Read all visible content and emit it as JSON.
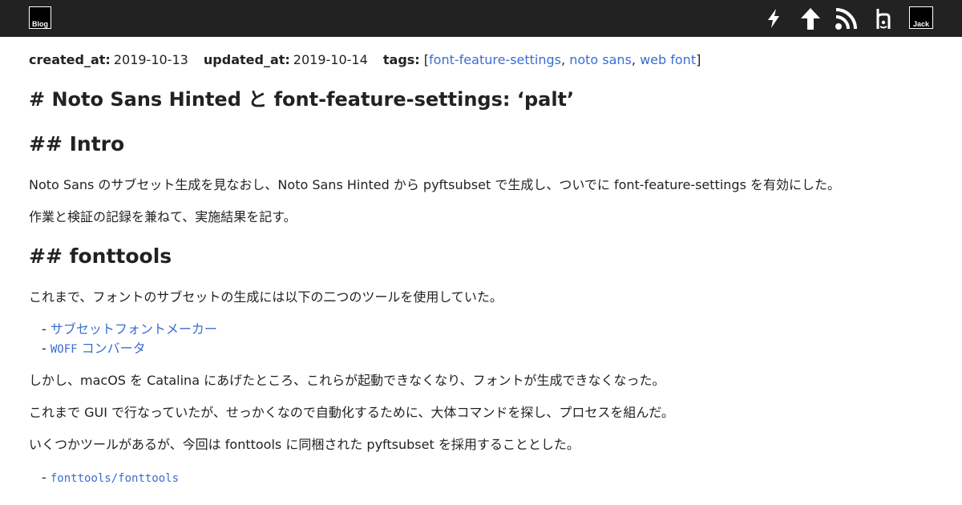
{
  "header": {
    "blog_label": "Blog",
    "jack_label": "Jack"
  },
  "meta": {
    "created_key": "created_at:",
    "created_value": "2019-10-13",
    "updated_key": "updated_at:",
    "updated_value": "2019-10-14",
    "tags_key": "tags:",
    "tags_open": "[",
    "tags_close": "]",
    "separator": ",",
    "tags": [
      "font-feature-settings",
      "noto sans",
      "web font"
    ]
  },
  "article": {
    "title": "# Noto Sans Hinted と font-feature-settings: ‘palt’",
    "intro_heading": "## Intro",
    "intro_p1": "Noto Sans のサブセット生成を見なおし、Noto Sans Hinted から pyftsubset で生成し、ついでに font-feature-settings を有効にした。",
    "intro_p2": "作業と検証の記録を兼ねて、実施結果を記す。",
    "fonttools_heading": "## fonttools",
    "fonttools_p1": "これまで、フォントのサブセットの生成には以下の二つのツールを使用していた。",
    "list_dash": "-",
    "tools": [
      "サブセットフォントメーカー",
      "WOFF コンバータ"
    ],
    "tool2_prefix": "WOFF",
    "tool2_suffix": " コンバータ",
    "fonttools_p2": "しかし、macOS を Catalina にあげたところ、これらが起動できなくなり、フォントが生成できなくなった。",
    "fonttools_p3": "これまで GUI で行なっていたが、せっかくなので自動化するために、大体コマンドを探し、プロセスを組んだ。",
    "fonttools_p4": "いくつかツールがあるが、今回は fonttools に同梱された pyftsubset を採用することとした。",
    "repo_link": "fonttools/fonttools"
  },
  "colors": {
    "header_bg": "#222222",
    "link": "#3a6dd1",
    "text": "#222222"
  },
  "icons": [
    "amp-icon",
    "arrow-up-icon",
    "rss-icon",
    "hatena-icon"
  ]
}
